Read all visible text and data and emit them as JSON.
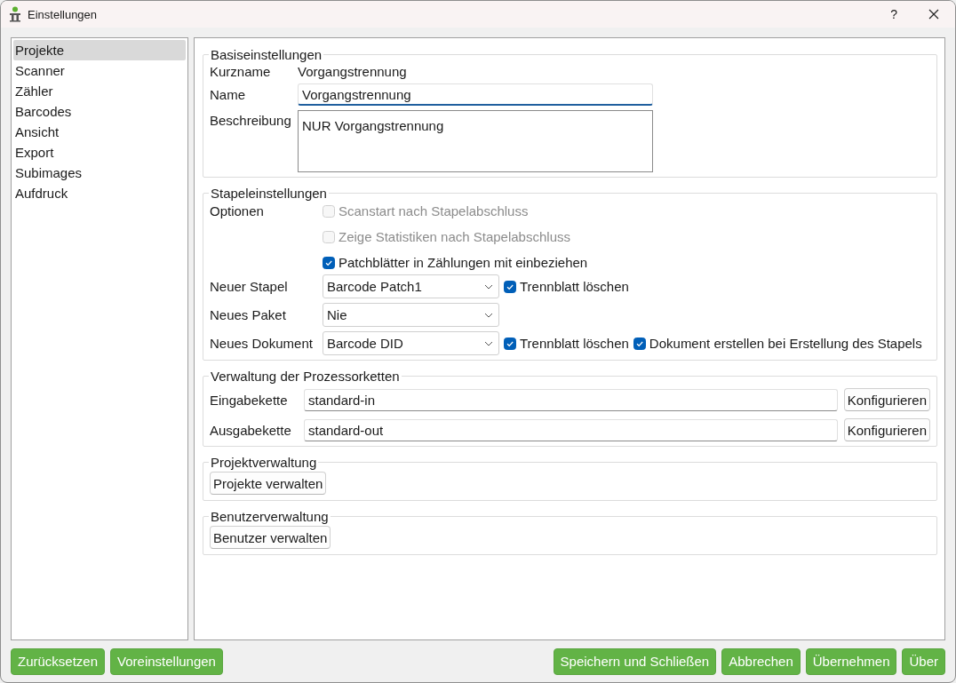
{
  "window": {
    "title": "Einstellungen",
    "help": "?"
  },
  "sidebar": {
    "items": [
      {
        "label": "Projekte",
        "selected": true
      },
      {
        "label": "Scanner",
        "selected": false
      },
      {
        "label": "Zähler",
        "selected": false
      },
      {
        "label": "Barcodes",
        "selected": false
      },
      {
        "label": "Ansicht",
        "selected": false
      },
      {
        "label": "Export",
        "selected": false
      },
      {
        "label": "Subimages",
        "selected": false
      },
      {
        "label": "Aufdruck",
        "selected": false
      }
    ]
  },
  "basic": {
    "title": "Basiseinstellungen",
    "short_name": {
      "label": "Kurzname",
      "value": "Vorgangstrennung"
    },
    "name": {
      "label": "Name",
      "value": "Vorgangstrennung"
    },
    "description": {
      "label": "Beschreibung",
      "value": "NUR Vorgangstrennung"
    }
  },
  "batch": {
    "title": "Stapeleinstellungen",
    "options_label": "Optionen",
    "options": [
      {
        "label": "Scanstart nach Stapelabschluss",
        "checked": false,
        "disabled": true
      },
      {
        "label": "Zeige Statistiken nach Stapelabschluss",
        "checked": false,
        "disabled": true
      },
      {
        "label": "Patchblätter in Zählungen mit einbeziehen",
        "checked": true,
        "disabled": false
      }
    ],
    "rows": [
      {
        "label": "Neuer Stapel",
        "value": "Barcode Patch1",
        "checks": [
          {
            "label": "Trennblatt löschen",
            "checked": true
          }
        ]
      },
      {
        "label": "Neues Paket",
        "value": "Nie"
      },
      {
        "label": "Neues Dokument",
        "value": "Barcode DID",
        "checks": [
          {
            "label": "Trennblatt löschen",
            "checked": true
          },
          {
            "label": "Dokument erstellen bei Erstellung des Stapels",
            "checked": true
          }
        ]
      }
    ]
  },
  "chains": {
    "title": "Verwaltung der Prozessorketten",
    "rows": [
      {
        "label": "Eingabekette",
        "value": "standard-in",
        "button": "Konfigurieren"
      },
      {
        "label": "Ausgabekette",
        "value": "standard-out",
        "button": "Konfigurieren"
      }
    ]
  },
  "projects": {
    "title": "Projektverwaltung",
    "button": "Projekte verwalten"
  },
  "users": {
    "title": "Benutzerverwaltung",
    "button": "Benutzer verwalten"
  },
  "footer": {
    "left": [
      "Zurücksetzen",
      "Voreinstellungen"
    ],
    "right": [
      "Speichern und Schließen",
      "Abbrechen",
      "Übernehmen",
      "Über"
    ]
  }
}
